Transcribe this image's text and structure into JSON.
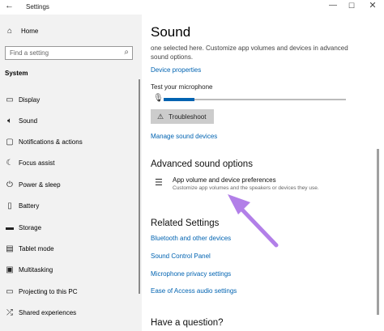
{
  "window": {
    "title": "Settings",
    "back_icon": "←",
    "minimize_icon": "—",
    "maximize_icon": "☐",
    "close_icon": "✕"
  },
  "sidebar": {
    "home_label": "Home",
    "search_placeholder": "Find a setting",
    "section_label": "System",
    "items": [
      {
        "label": "Display",
        "icon": "display-icon"
      },
      {
        "label": "Sound",
        "icon": "speaker-icon"
      },
      {
        "label": "Notifications & actions",
        "icon": "notification-icon"
      },
      {
        "label": "Focus assist",
        "icon": "moon-icon"
      },
      {
        "label": "Power & sleep",
        "icon": "power-icon"
      },
      {
        "label": "Battery",
        "icon": "battery-icon"
      },
      {
        "label": "Storage",
        "icon": "storage-icon"
      },
      {
        "label": "Tablet mode",
        "icon": "tablet-icon"
      },
      {
        "label": "Multitasking",
        "icon": "multitasking-icon"
      },
      {
        "label": "Projecting to this PC",
        "icon": "projecting-icon"
      },
      {
        "label": "Shared experiences",
        "icon": "shared-icon"
      }
    ]
  },
  "main": {
    "title": "Sound",
    "description": "one selected here. Customize app volumes and devices in advanced sound options.",
    "device_properties_link": "Device properties",
    "test_mic_label": "Test your microphone",
    "mic_level": 0.17,
    "troubleshoot_label": "Troubleshoot",
    "manage_devices_link": "Manage sound devices",
    "advanced_heading": "Advanced sound options",
    "app_volume_title": "App volume and device preferences",
    "app_volume_desc": "Customize app volumes and the speakers or devices they use.",
    "related_heading": "Related Settings",
    "related_links": [
      "Bluetooth and other devices",
      "Sound Control Panel",
      "Microphone privacy settings",
      "Ease of Access audio settings"
    ],
    "question_heading": "Have a question?"
  },
  "colors": {
    "link": "#0063b1",
    "annotation_arrow": "#b27fe8"
  }
}
